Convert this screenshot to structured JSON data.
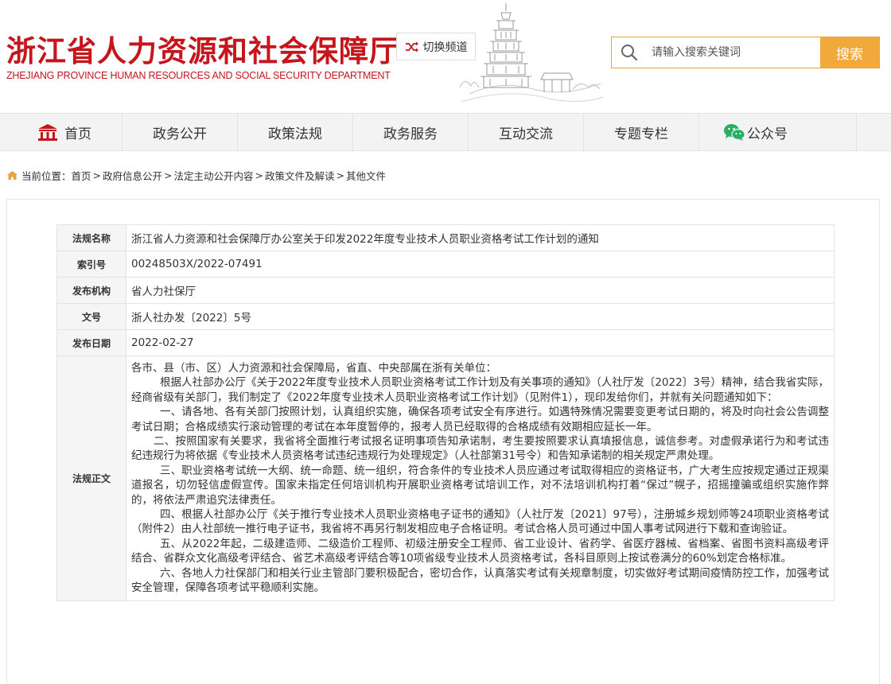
{
  "header": {
    "title_cn": "浙江省人力资源和社会保障厅",
    "title_en": "ZHEJIANG PROVINCE HUMAN RESOURCES AND SOCIAL SECURITY DEPARTMENT",
    "switch_label": "切换频道",
    "search_placeholder": "请输入搜索关键词",
    "search_button": "搜索"
  },
  "nav": {
    "items": [
      {
        "label": "首页",
        "icon": "home-icon"
      },
      {
        "label": "政务公开"
      },
      {
        "label": "政策法规"
      },
      {
        "label": "政务服务"
      },
      {
        "label": "互动交流"
      },
      {
        "label": "专题专栏"
      },
      {
        "label": "公众号",
        "icon": "wechat-icon"
      }
    ]
  },
  "breadcrumb": {
    "prefix": "当前位置：",
    "items": [
      "首页",
      "政府信息公开",
      "法定主动公开内容",
      "政策文件及解读",
      "其他文件"
    ],
    "separator": ">"
  },
  "meta": {
    "rows": [
      {
        "key": "法规名称",
        "value": "浙江省人力资源和社会保障厅办公室关于印发2022年度专业技术人员职业资格考试工作计划的通知"
      },
      {
        "key": "索引号",
        "value": "00248503X/2022-07491"
      },
      {
        "key": "发布机构",
        "value": "省人力社保厅"
      },
      {
        "key": "文号",
        "value": "浙人社办发〔2022〕5号"
      },
      {
        "key": "发布日期",
        "value": "2022-02-27"
      }
    ],
    "body_key": "法规正文",
    "body": [
      "各市、县（市、区）人力资源和社会保障局，省直、中央部属在浙有关单位：",
      "根据人社部办公厅《关于2022年度专业技术人员职业资格考试工作计划及有关事项的通知》（人社厅发〔2022〕3号）精神，结合我省实际，经商省级有关部门，我们制定了《2022年度专业技术人员职业资格考试工作计划》（见附件1），现印发给你们，并就有关问题通知如下：",
      "一、请各地、各有关部门按照计划，认真组织实施，确保各项考试安全有序进行。如遇特殊情况需要变更考试日期的，将及时向社会公告调整考试日期；合格成绩实行滚动管理的考试在本年度暂停的，报考人员已经取得的合格成绩有效期相应延长一年。",
      "二、按照国家有关要求，我省将全面推行考试报名证明事项告知承诺制，考生要按照要求认真填报信息，诚信参考。对虚假承诺行为和考试违纪违规行为将依据《专业技术人员资格考试违纪违规行为处理规定》（人社部第31号令）和告知承诺制的相关规定严肃处理。",
      "三、职业资格考试统一大纲、统一命题、统一组织，符合条件的专业技术人员应通过考试取得相应的资格证书，广大考生应按规定通过正规渠道报名，切勿轻信虚假宣传。国家未指定任何培训机构开展职业资格考试培训工作，对不法培训机构打着“保过”幌子，招摇撞骗或组织实施作弊的，将依法严肃追究法律责任。",
      "四、根据人社部办公厅《关于推行专业技术人员职业资格电子证书的通知》（人社厅发〔2021〕97号），注册城乡规划师等24项职业资格考试（附件2）由人社部统一推行电子证书，我省将不再另行制发相应电子合格证明。考试合格人员可通过中国人事考试网进行下载和查询验证。",
      "五、从2022年起，二级建造师、二级造价工程师、初级注册安全工程师、省工业设计、省药学、省医疗器械、省档案、省图书资料高级考评结合、省群众文化高级考评结合、省艺术高级考评结合等10项省级专业技术人员资格考试，各科目原则上按试卷满分的60%划定合格标准。",
      "六、各地人力社保部门和相关行业主管部门要积极配合，密切合作，认真落实考试有关规章制度，切实做好考试期间疫情防控工作，加强考试安全管理，保障各项考试平稳顺利实施。"
    ]
  },
  "colors": {
    "brand_red": "#c4161c",
    "accent_orange": "#f0a93a"
  }
}
